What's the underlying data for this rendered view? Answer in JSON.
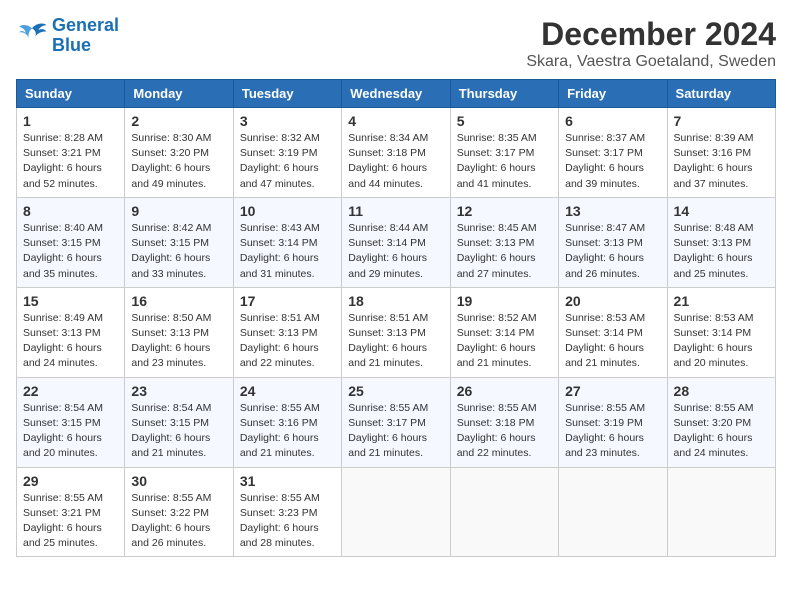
{
  "logo": {
    "line1": "General",
    "line2": "Blue"
  },
  "title": "December 2024",
  "subtitle": "Skara, Vaestra Goetaland, Sweden",
  "days_of_week": [
    "Sunday",
    "Monday",
    "Tuesday",
    "Wednesday",
    "Thursday",
    "Friday",
    "Saturday"
  ],
  "weeks": [
    [
      {
        "day": 1,
        "sunrise": "8:28 AM",
        "sunset": "3:21 PM",
        "daylight": "6 hours and 52 minutes."
      },
      {
        "day": 2,
        "sunrise": "8:30 AM",
        "sunset": "3:20 PM",
        "daylight": "6 hours and 49 minutes."
      },
      {
        "day": 3,
        "sunrise": "8:32 AM",
        "sunset": "3:19 PM",
        "daylight": "6 hours and 47 minutes."
      },
      {
        "day": 4,
        "sunrise": "8:34 AM",
        "sunset": "3:18 PM",
        "daylight": "6 hours and 44 minutes."
      },
      {
        "day": 5,
        "sunrise": "8:35 AM",
        "sunset": "3:17 PM",
        "daylight": "6 hours and 41 minutes."
      },
      {
        "day": 6,
        "sunrise": "8:37 AM",
        "sunset": "3:17 PM",
        "daylight": "6 hours and 39 minutes."
      },
      {
        "day": 7,
        "sunrise": "8:39 AM",
        "sunset": "3:16 PM",
        "daylight": "6 hours and 37 minutes."
      }
    ],
    [
      {
        "day": 8,
        "sunrise": "8:40 AM",
        "sunset": "3:15 PM",
        "daylight": "6 hours and 35 minutes."
      },
      {
        "day": 9,
        "sunrise": "8:42 AM",
        "sunset": "3:15 PM",
        "daylight": "6 hours and 33 minutes."
      },
      {
        "day": 10,
        "sunrise": "8:43 AM",
        "sunset": "3:14 PM",
        "daylight": "6 hours and 31 minutes."
      },
      {
        "day": 11,
        "sunrise": "8:44 AM",
        "sunset": "3:14 PM",
        "daylight": "6 hours and 29 minutes."
      },
      {
        "day": 12,
        "sunrise": "8:45 AM",
        "sunset": "3:13 PM",
        "daylight": "6 hours and 27 minutes."
      },
      {
        "day": 13,
        "sunrise": "8:47 AM",
        "sunset": "3:13 PM",
        "daylight": "6 hours and 26 minutes."
      },
      {
        "day": 14,
        "sunrise": "8:48 AM",
        "sunset": "3:13 PM",
        "daylight": "6 hours and 25 minutes."
      }
    ],
    [
      {
        "day": 15,
        "sunrise": "8:49 AM",
        "sunset": "3:13 PM",
        "daylight": "6 hours and 24 minutes."
      },
      {
        "day": 16,
        "sunrise": "8:50 AM",
        "sunset": "3:13 PM",
        "daylight": "6 hours and 23 minutes."
      },
      {
        "day": 17,
        "sunrise": "8:51 AM",
        "sunset": "3:13 PM",
        "daylight": "6 hours and 22 minutes."
      },
      {
        "day": 18,
        "sunrise": "8:51 AM",
        "sunset": "3:13 PM",
        "daylight": "6 hours and 21 minutes."
      },
      {
        "day": 19,
        "sunrise": "8:52 AM",
        "sunset": "3:14 PM",
        "daylight": "6 hours and 21 minutes."
      },
      {
        "day": 20,
        "sunrise": "8:53 AM",
        "sunset": "3:14 PM",
        "daylight": "6 hours and 21 minutes."
      },
      {
        "day": 21,
        "sunrise": "8:53 AM",
        "sunset": "3:14 PM",
        "daylight": "6 hours and 20 minutes."
      }
    ],
    [
      {
        "day": 22,
        "sunrise": "8:54 AM",
        "sunset": "3:15 PM",
        "daylight": "6 hours and 20 minutes."
      },
      {
        "day": 23,
        "sunrise": "8:54 AM",
        "sunset": "3:15 PM",
        "daylight": "6 hours and 21 minutes."
      },
      {
        "day": 24,
        "sunrise": "8:55 AM",
        "sunset": "3:16 PM",
        "daylight": "6 hours and 21 minutes."
      },
      {
        "day": 25,
        "sunrise": "8:55 AM",
        "sunset": "3:17 PM",
        "daylight": "6 hours and 21 minutes."
      },
      {
        "day": 26,
        "sunrise": "8:55 AM",
        "sunset": "3:18 PM",
        "daylight": "6 hours and 22 minutes."
      },
      {
        "day": 27,
        "sunrise": "8:55 AM",
        "sunset": "3:19 PM",
        "daylight": "6 hours and 23 minutes."
      },
      {
        "day": 28,
        "sunrise": "8:55 AM",
        "sunset": "3:20 PM",
        "daylight": "6 hours and 24 minutes."
      }
    ],
    [
      {
        "day": 29,
        "sunrise": "8:55 AM",
        "sunset": "3:21 PM",
        "daylight": "6 hours and 25 minutes."
      },
      {
        "day": 30,
        "sunrise": "8:55 AM",
        "sunset": "3:22 PM",
        "daylight": "6 hours and 26 minutes."
      },
      {
        "day": 31,
        "sunrise": "8:55 AM",
        "sunset": "3:23 PM",
        "daylight": "6 hours and 28 minutes."
      },
      null,
      null,
      null,
      null
    ]
  ]
}
